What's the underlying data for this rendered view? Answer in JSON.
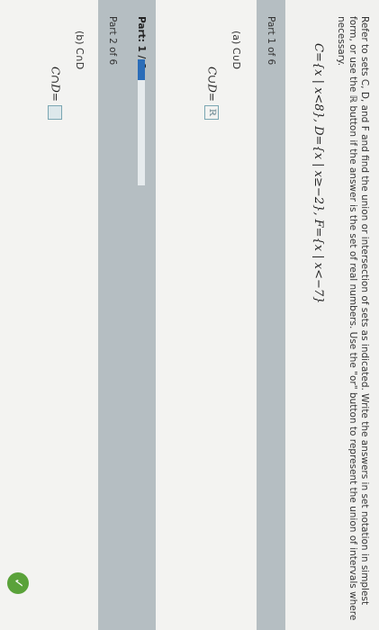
{
  "intro_text": "Refer to sets C, D, and F and find the union or intersection of sets as indicated. Write the answers in set notation in simplest form, or use the ℝ button if the answer is the set of real numbers. Use the \"or\" button to represent the union of intervals where necessary.",
  "sets_definition": "C={x | x<8}, D={x | x≥−2}, F={x | x<−7}",
  "part1": {
    "header": "Part 1 of 6",
    "label": "(a) C∪D",
    "expression": "C∪D=",
    "answer": "ℝ"
  },
  "progress": {
    "label": "Part: 1 / 6",
    "current": 1,
    "total": 6
  },
  "part2": {
    "header": "Part 2 of 6",
    "label": "(b) C∩D",
    "expression": "C∩D=",
    "answer": ""
  },
  "colors": {
    "accent": "#2b6db8",
    "header_bg": "#b5bec2",
    "check": "#5aa23a"
  },
  "icons": [
    "check-icon"
  ]
}
